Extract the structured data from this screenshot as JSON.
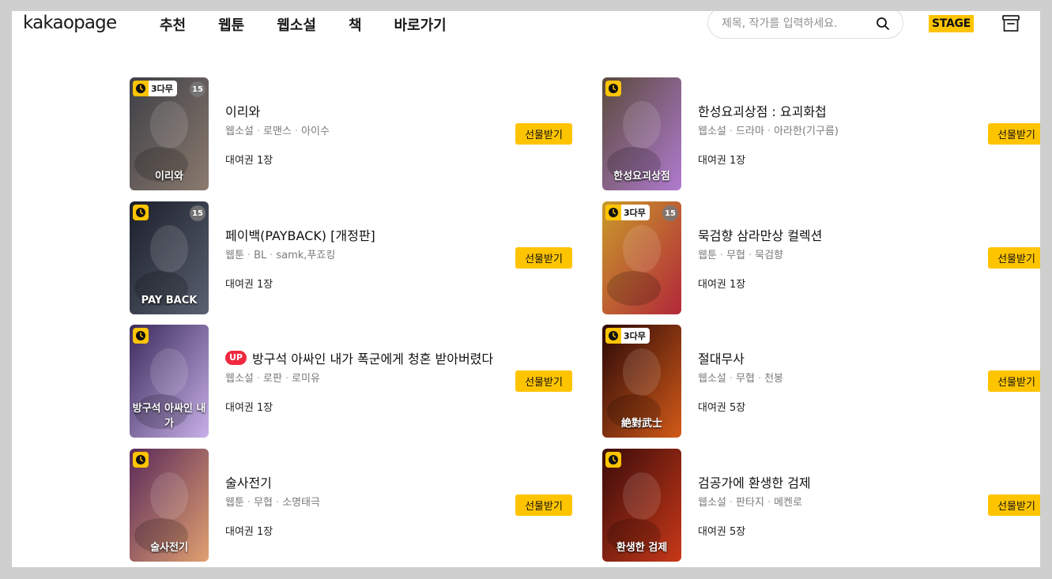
{
  "header": {
    "logo": "kakaopage",
    "nav": [
      "추천",
      "웹툰",
      "웹소설",
      "책",
      "바로가기"
    ],
    "search_placeholder": "제목, 작가를 입력하세요.",
    "stage_label": "STAGE"
  },
  "items": [
    {
      "title": "이리와",
      "up": false,
      "genre": [
        "웹소설",
        "로맨스",
        "아이수"
      ],
      "ticket": "대여권 1장",
      "badge": "3다무",
      "age": "15",
      "cover_text": "이리와",
      "cover_colors": [
        "#3d3f46",
        "#8b7a6e"
      ]
    },
    {
      "title": "한성요괴상점 : 요괴화첩",
      "up": false,
      "genre": [
        "웹소설",
        "드라마",
        "아라한(기구름)"
      ],
      "ticket": "대여권 1장",
      "badge": "",
      "age": "",
      "cover_text": "한성요괴상점",
      "cover_colors": [
        "#5a4a3a",
        "#b07bd0"
      ]
    },
    {
      "title": "페이백(PAYBACK) [개정판]",
      "up": false,
      "genre": [
        "웹툰",
        "BL",
        "samk,푸죠킹"
      ],
      "ticket": "대여권 1장",
      "badge": "",
      "age": "15",
      "cover_text": "PAY BACK",
      "cover_colors": [
        "#1b1f2a",
        "#5a6070"
      ]
    },
    {
      "title": "묵검향 삼라만상 컬렉션",
      "up": false,
      "genre": [
        "웹툰",
        "무협",
        "묵검향"
      ],
      "ticket": "대여권 1장",
      "badge": "3다무",
      "age": "15",
      "cover_text": "",
      "cover_colors": [
        "#c99a2a",
        "#b2283a"
      ]
    },
    {
      "title": "방구석 아싸인 내가 폭군에게 청혼 받아버렸다",
      "up": true,
      "up_label": "UP",
      "genre": [
        "웹소설",
        "로판",
        "로미유"
      ],
      "ticket": "대여권 1장",
      "badge": "",
      "age": "",
      "cover_text": "방구석 아싸인 내가",
      "cover_colors": [
        "#3a2a5a",
        "#c8b0e8"
      ]
    },
    {
      "title": "절대무사",
      "up": false,
      "genre": [
        "웹소설",
        "무협",
        "천봉"
      ],
      "ticket": "대여권 5장",
      "badge": "3다무",
      "age": "",
      "cover_text": "絶對武士",
      "cover_colors": [
        "#2a0808",
        "#d25a18"
      ]
    },
    {
      "title": "술사전기",
      "up": false,
      "genre": [
        "웹툰",
        "무협",
        "소명태극"
      ],
      "ticket": "대여권 1장",
      "badge": "",
      "age": "",
      "cover_text": "술사전기",
      "cover_colors": [
        "#5a2a5a",
        "#e0a070"
      ]
    },
    {
      "title": "검공가에 환생한 검제",
      "up": false,
      "genre": [
        "웹소설",
        "판타지",
        "메켄로"
      ],
      "ticket": "대여권 5장",
      "badge": "",
      "age": "",
      "cover_text": "환생한 검제",
      "cover_colors": [
        "#3a0c0a",
        "#c83818"
      ]
    }
  ],
  "gift_label": "선물받기",
  "colors": {
    "accent": "#ffc400",
    "up_badge": "#f0293e",
    "meta": "#7a7a7a"
  }
}
